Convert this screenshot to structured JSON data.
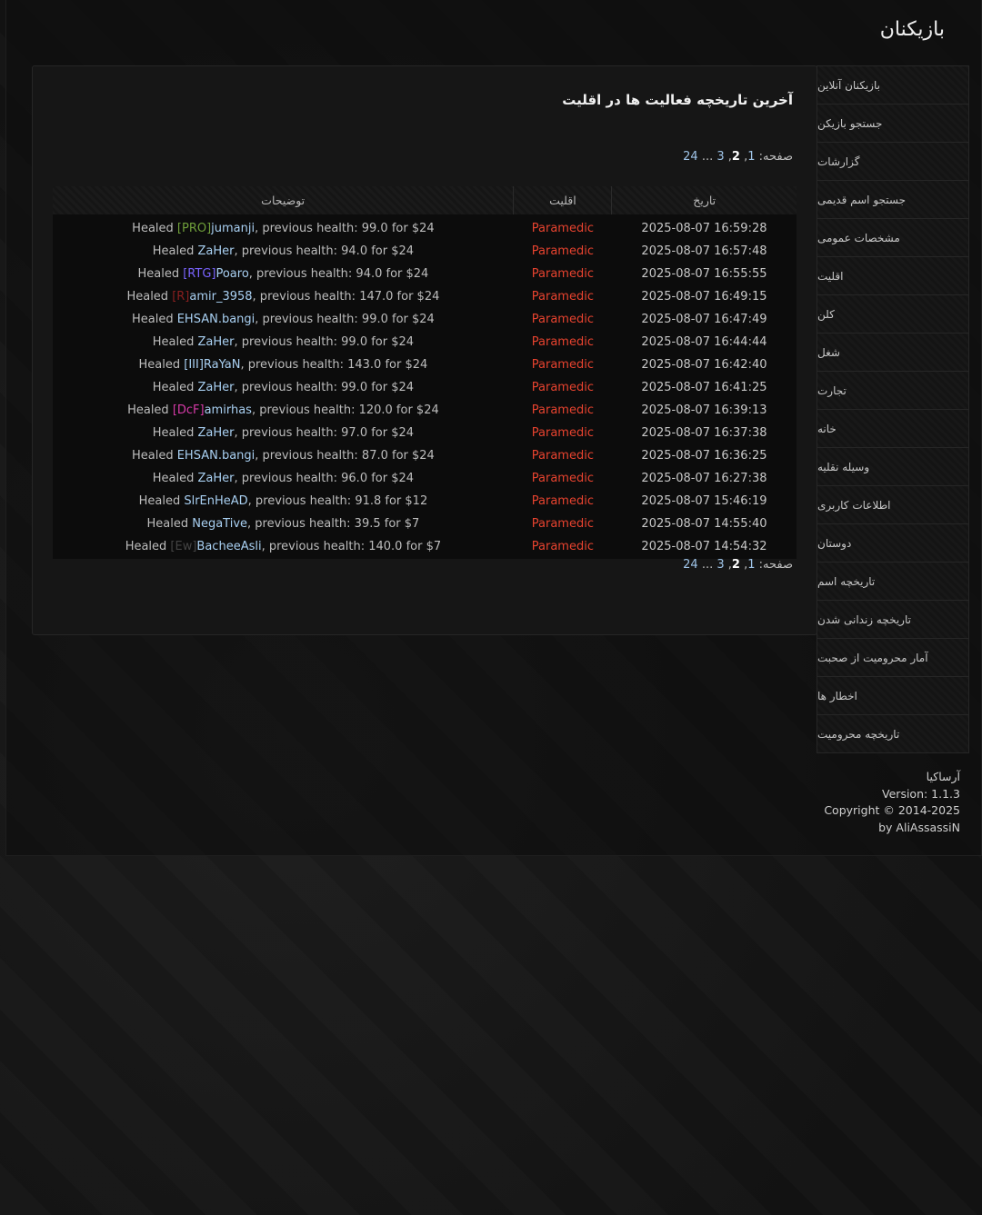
{
  "site_title": "بازیکنان",
  "main": {
    "heading": "آخرین تاریخچه فعالیت ها در اقلیت",
    "pager": {
      "label": "صفحه:",
      "pages": [
        "1",
        "2",
        "3",
        "...",
        "24"
      ],
      "current": "2"
    },
    "table": {
      "headers": {
        "date": "تاریخ",
        "faction": "اقلیت",
        "description": "توضیحات"
      },
      "rows": [
        {
          "date": "2025-08-07 16:59:28",
          "faction": "Paramedic",
          "prefix": "Healed ",
          "tag": "[PRO]",
          "tag_color": "#6f9f3a",
          "player": "jumanji",
          "rest": ", previous health: 99.0 for $24"
        },
        {
          "date": "2025-08-07 16:57:48",
          "faction": "Paramedic",
          "prefix": "Healed ",
          "tag": "",
          "tag_color": "",
          "player": "ZaHer",
          "rest": ", previous health: 94.0 for $24"
        },
        {
          "date": "2025-08-07 16:55:55",
          "faction": "Paramedic",
          "prefix": "Healed ",
          "tag": "[RTG]",
          "tag_color": "#7a64ff",
          "player": "Poaro",
          "rest": ", previous health: 94.0 for $24"
        },
        {
          "date": "2025-08-07 16:49:15",
          "faction": "Paramedic",
          "prefix": "Healed ",
          "tag": "[R]",
          "tag_color": "#8a1f1f",
          "player": "amir_3958",
          "rest": ", previous health: 147.0 for $24"
        },
        {
          "date": "2025-08-07 16:47:49",
          "faction": "Paramedic",
          "prefix": "Healed ",
          "tag": "",
          "tag_color": "",
          "player": "EHSAN.bangi",
          "rest": ", previous health: 99.0 for $24"
        },
        {
          "date": "2025-08-07 16:44:44",
          "faction": "Paramedic",
          "prefix": "Healed ",
          "tag": "",
          "tag_color": "",
          "player": "ZaHer",
          "rest": ", previous health: 99.0 for $24"
        },
        {
          "date": "2025-08-07 16:42:40",
          "faction": "Paramedic",
          "prefix": "Healed ",
          "tag": "",
          "tag_color": "",
          "player": "[III]RaYaN",
          "rest": ", previous health: 143.0 for $24"
        },
        {
          "date": "2025-08-07 16:41:25",
          "faction": "Paramedic",
          "prefix": "Healed ",
          "tag": "",
          "tag_color": "",
          "player": "ZaHer",
          "rest": ", previous health: 99.0 for $24"
        },
        {
          "date": "2025-08-07 16:39:13",
          "faction": "Paramedic",
          "prefix": "Healed ",
          "tag": "[DcF]",
          "tag_color": "#d63aa8",
          "player": "amirhas",
          "rest": ", previous health: 120.0 for $24"
        },
        {
          "date": "2025-08-07 16:37:38",
          "faction": "Paramedic",
          "prefix": "Healed ",
          "tag": "",
          "tag_color": "",
          "player": "ZaHer",
          "rest": ", previous health: 97.0 for $24"
        },
        {
          "date": "2025-08-07 16:36:25",
          "faction": "Paramedic",
          "prefix": "Healed ",
          "tag": "",
          "tag_color": "",
          "player": "EHSAN.bangi",
          "rest": ", previous health: 87.0 for $24"
        },
        {
          "date": "2025-08-07 16:27:38",
          "faction": "Paramedic",
          "prefix": "Healed ",
          "tag": "",
          "tag_color": "",
          "player": "ZaHer",
          "rest": ", previous health: 96.0 for $24"
        },
        {
          "date": "2025-08-07 15:46:19",
          "faction": "Paramedic",
          "prefix": "Healed ",
          "tag": "",
          "tag_color": "",
          "player": "SlrEnHeAD",
          "rest": ", previous health: 91.8 for $12"
        },
        {
          "date": "2025-08-07 14:55:40",
          "faction": "Paramedic",
          "prefix": "Healed ",
          "tag": "",
          "tag_color": "",
          "player": "NegaTive",
          "rest": ", previous health: 39.5 for $7"
        },
        {
          "date": "2025-08-07 14:54:32",
          "faction": "Paramedic",
          "prefix": "Healed ",
          "tag": "[Ew]",
          "tag_color": "#444444",
          "player": "BacheeAsli",
          "rest": ", previous health: 140.0 for $7"
        }
      ]
    }
  },
  "sidebar": {
    "items": [
      "بازیکنان آنلاین",
      "جستجو بازیکن",
      "گزارشات",
      "جستجو اسم قدیمی",
      "مشخصات عمومی",
      "اقلیت",
      "کلن",
      "شغل",
      "تجارت",
      "خانه",
      "وسیله نقلیه",
      "اطلاعات کاربری",
      "دوستان",
      "تاریخچه اسم",
      "تاریخچه زندانی شدن",
      "آمار محرومیت از صحبت",
      "اخطار ها",
      "تاریخچه محرومیت"
    ]
  },
  "footer": {
    "name": "آرساکیا",
    "version": "Version: 1.1.3",
    "copyright": "Copyright © 2014-2025",
    "author": "by AliAssassiN"
  }
}
